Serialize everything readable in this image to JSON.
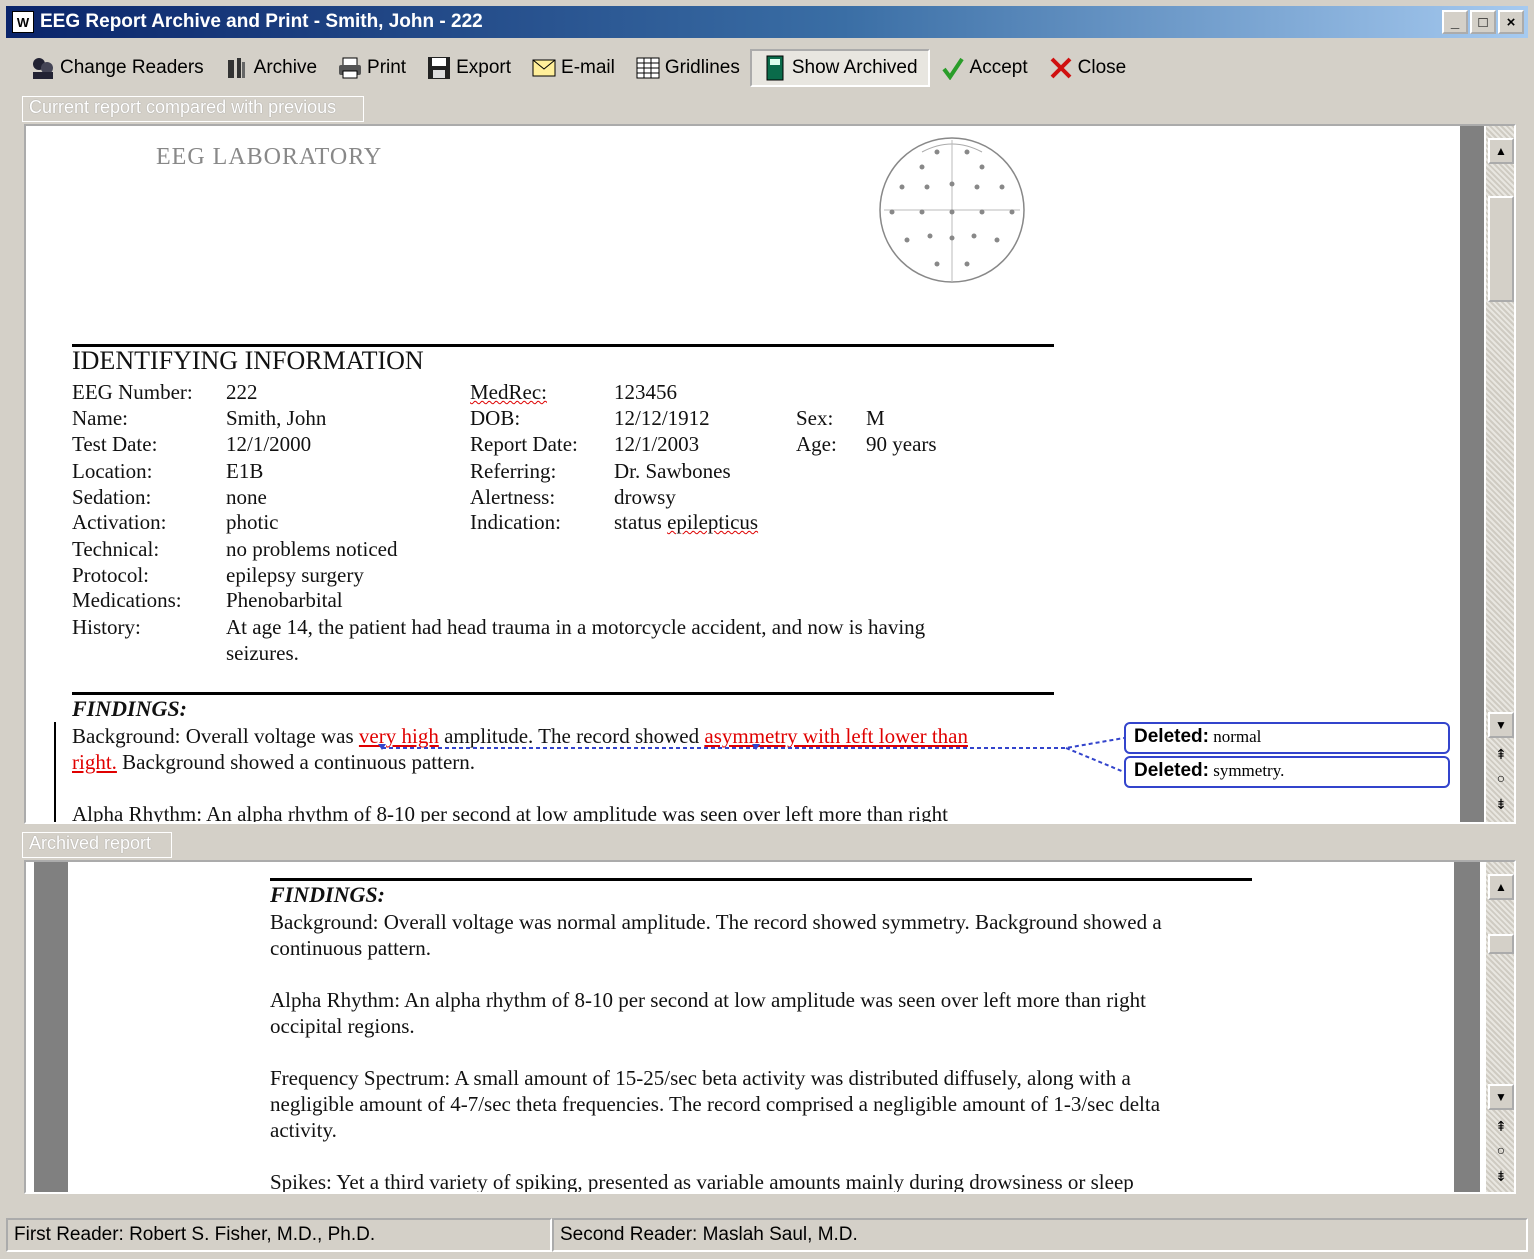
{
  "window": {
    "title": "EEG Report Archive and Print - Smith, John - 222",
    "controls": [
      "_",
      "□",
      "×"
    ]
  },
  "toolbar": {
    "change_readers": "Change Readers",
    "archive": "Archive",
    "print": "Print",
    "export": "Export",
    "email": "E-mail",
    "gridlines": "Gridlines",
    "show_archived": "Show Archived",
    "accept": "Accept",
    "close": "Close"
  },
  "current_pane": {
    "caption": "Current report compared with previous",
    "lab_title": "EEG LABORATORY",
    "identifying_heading": "IDENTIFYING INFORMATION",
    "fields": {
      "eeg_number_label": "EEG Number:",
      "eeg_number": "222",
      "medrec_label": "MedRec:",
      "medrec": "123456",
      "name_label": "Name:",
      "name": "Smith, John",
      "dob_label": "DOB:",
      "dob": "12/12/1912",
      "sex_label": "Sex:",
      "sex": "M",
      "test_date_label": "Test Date:",
      "test_date": "12/1/2000",
      "report_date_label": "Report Date:",
      "report_date": "12/1/2003",
      "age_label": "Age:",
      "age": "90 years",
      "location_label": "Location:",
      "location": "E1B",
      "referring_label": "Referring:",
      "referring": "Dr. Sawbones",
      "sedation_label": "Sedation:",
      "sedation": "none",
      "alertness_label": "Alertness:",
      "alertness": "drowsy",
      "activation_label": "Activation:",
      "activation": "photic",
      "indication_label": "Indication:",
      "indication_pre": "status ",
      "indication_word": "epilepticus",
      "technical_label": "Technical:",
      "technical": "no problems noticed",
      "protocol_label": "Protocol:",
      "protocol": "epilepsy surgery",
      "medications_label": "Medications:",
      "medications": "Phenobarbital",
      "history_label": "History:",
      "history_line1": "At age 14, the patient had head trauma in a motorcycle accident, and now is having",
      "history_line2": "seizures."
    },
    "findings_heading": "FINDINGS:",
    "bg_a": "Background: Overall voltage was ",
    "bg_ins1": "very high",
    "bg_b": " amplitude. The record showed ",
    "bg_ins2": "asymmetry with left lower than",
    "bg_ins3": "right.",
    "bg_c": " Background showed a continuous pattern.",
    "alpha_partial": "Alpha Rhythm: An alpha rhythm of 8-10 per second at low amplitude was seen over left more than right",
    "deleted_label": "Deleted:",
    "deleted_1": "normal",
    "deleted_2": "symmetry."
  },
  "archived_pane": {
    "caption": "Archived report",
    "findings_heading": "FINDINGS:",
    "bg_line1": "Background: Overall voltage was normal amplitude. The record showed symmetry. Background showed a",
    "bg_line2": "continuous pattern.",
    "alpha_line1": "Alpha Rhythm: An alpha rhythm of 8-10 per second at low amplitude was seen over left more than right",
    "alpha_line2": "occipital regions.",
    "freq_line1": "Frequency Spectrum: A small amount of 15-25/sec beta activity was distributed diffusely, along with a",
    "freq_line2": "negligible amount of 4-7/sec theta frequencies. The record comprised a negligible amount of 1-3/sec delta",
    "freq_line3": "activity.",
    "spikes_partial": "Spikes: Yet a third variety of spiking, presented as variable amounts mainly during drowsiness or sleep"
  },
  "status": {
    "first_reader": "First Reader:  Robert S. Fisher,  M.D., Ph.D.",
    "second_reader": "Second Reader:  Maslah Saul,  M.D."
  },
  "colors": {
    "title_bar": "#0a246a",
    "insertion": "#e00000",
    "balloon_border": "#3344cc"
  },
  "icons": [
    "app-icon",
    "readers-icon",
    "archive-icon",
    "printer-icon",
    "floppy-disk-icon",
    "envelope-icon",
    "grid-icon",
    "book-icon",
    "checkmark-icon",
    "red-x-icon",
    "head-electrode-diagram"
  ]
}
